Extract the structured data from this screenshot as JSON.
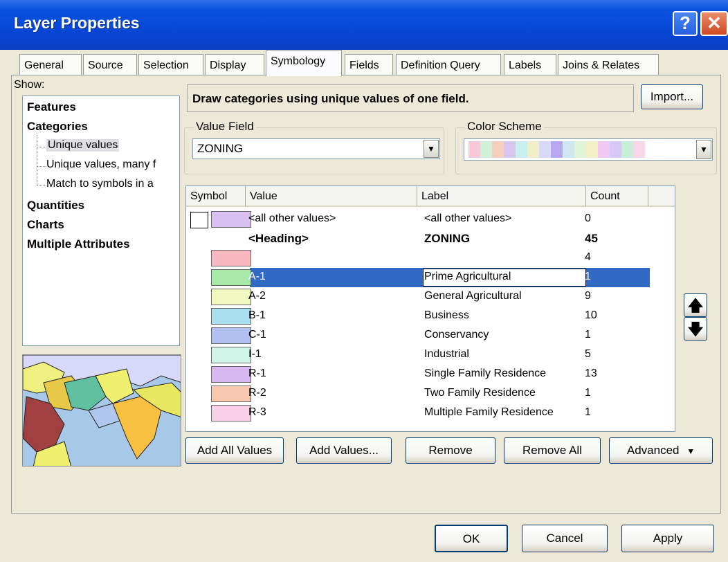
{
  "window": {
    "title": "Layer Properties",
    "help_glyph": "?",
    "close_glyph": "✕"
  },
  "tabs": [
    {
      "label": "General"
    },
    {
      "label": "Source"
    },
    {
      "label": "Selection"
    },
    {
      "label": "Display"
    },
    {
      "label": "Symbology",
      "active": true
    },
    {
      "label": "Fields"
    },
    {
      "label": "Definition Query"
    },
    {
      "label": "Labels"
    },
    {
      "label": "Joins & Relates"
    }
  ],
  "show": {
    "label": "Show:",
    "tree": [
      "Features",
      "Categories",
      "Unique values",
      "Unique values, many f",
      "Match to symbols in a",
      "Quantities",
      "Charts",
      "Multiple Attributes"
    ],
    "selected": "Unique values"
  },
  "description": "Draw categories using unique values of one field.",
  "import_label": "Import...",
  "value_field": {
    "legend": "Value Field",
    "value": "ZONING"
  },
  "color_scheme": {
    "legend": "Color Scheme",
    "colors": [
      "#f8c8d8",
      "#d0f0d8",
      "#f8d0c0",
      "#d8c8f0",
      "#c8f0f0",
      "#f0f0c8",
      "#d8d8f8",
      "#b8a8f0",
      "#d0e8f0",
      "#e0f4d8",
      "#f4f0c8",
      "#f0c8f0",
      "#d8c8f8",
      "#c8f0d8",
      "#f8d8e8"
    ]
  },
  "columns": {
    "symbol": "Symbol",
    "value": "Value",
    "label": "Label",
    "count": "Count"
  },
  "rows": [
    {
      "value": "<all other values>",
      "label": "<all other values>",
      "count": "0",
      "color": "#d8c0f0",
      "white": true
    },
    {
      "value": "<Heading>",
      "label": "ZONING",
      "count": "45",
      "heading": true
    },
    {
      "value": "",
      "label": "",
      "count": "4",
      "color": "#f8b8c0"
    },
    {
      "value": "A-1",
      "label": "Prime Agricultural",
      "count": "1",
      "color": "#a8e8a8",
      "selected": true
    },
    {
      "value": "A-2",
      "label": "General Agricultural",
      "count": "9",
      "color": "#f0f8c0"
    },
    {
      "value": "B-1",
      "label": "Business",
      "count": "10",
      "color": "#a8e0f0"
    },
    {
      "value": "C-1",
      "label": "Conservancy",
      "count": "1",
      "color": "#b0c0f0"
    },
    {
      "value": "I-1",
      "label": "Industrial",
      "count": "5",
      "color": "#d0f4e8"
    },
    {
      "value": "R-1",
      "label": "Single Family Residence",
      "count": "13",
      "color": "#d8b8f0"
    },
    {
      "value": "R-2",
      "label": "Two Family Residence",
      "count": "1",
      "color": "#f8c8b0"
    },
    {
      "value": "R-3",
      "label": "Multiple Family Residence",
      "count": "1",
      "color": "#f8d0e8"
    }
  ],
  "buttons": {
    "add_all": "Add All Values",
    "add": "Add Values...",
    "remove": "Remove",
    "remove_all": "Remove All",
    "advanced": "Advanced",
    "up_glyph": "🡅",
    "down_glyph": "🡇",
    "ok": "OK",
    "cancel": "Cancel",
    "apply": "Apply"
  }
}
